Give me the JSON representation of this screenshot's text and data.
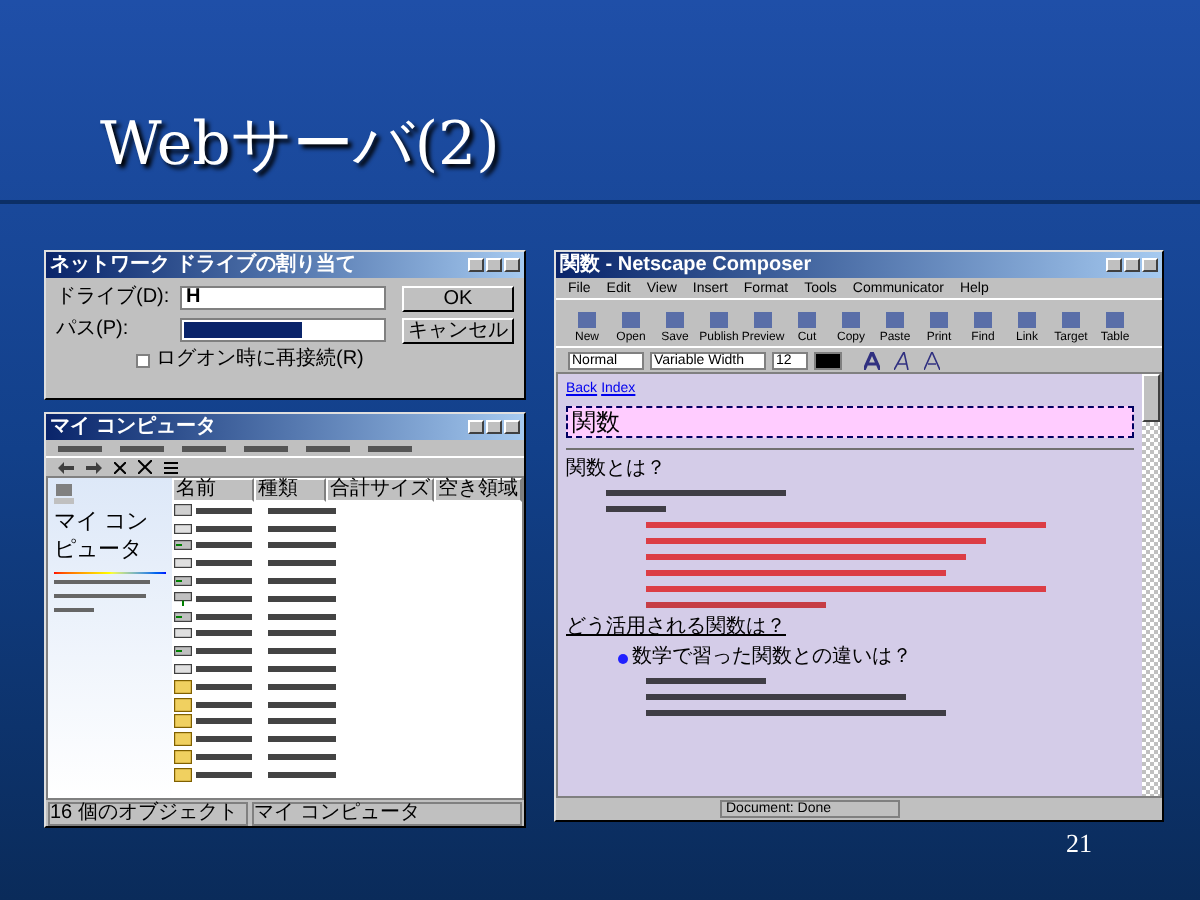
{
  "slide": {
    "title": "Webサーバ(2)",
    "page_number": "21"
  },
  "map_drive_dialog": {
    "title": "ネットワーク ドライブの割り当て",
    "drive_label": "ドライブ(D):",
    "drive_value": "H",
    "path_label": "パス(P):",
    "reconnect": {
      "label": "ログオン時に再接続(R)",
      "checked": false
    },
    "buttons": [
      "OK",
      "キャンセル"
    ]
  },
  "explorer": {
    "title": "マイ コンピュータ",
    "sidebar_title": "マイ コンピュータ",
    "columns": [
      "名前",
      "種類",
      "合計サイズ",
      "空き領域"
    ],
    "rows": [
      {
        "kind": "floppy"
      },
      {
        "kind": "hdd"
      },
      {
        "kind": "cd"
      },
      {
        "kind": "hdd"
      },
      {
        "kind": "cd"
      },
      {
        "kind": "net"
      },
      {
        "kind": "cd"
      },
      {
        "kind": "hdd"
      },
      {
        "kind": "cd"
      },
      {
        "kind": "hdd"
      },
      {
        "kind": "folder"
      },
      {
        "kind": "folder"
      },
      {
        "kind": "folder"
      },
      {
        "kind": "folder"
      },
      {
        "kind": "folder"
      },
      {
        "kind": "folder"
      }
    ],
    "status": [
      "16 個のオブジェクト",
      "マイ コンピュータ"
    ]
  },
  "composer": {
    "title": "関数 - Netscape Composer",
    "menu": [
      "File",
      "Edit",
      "View",
      "Insert",
      "Format",
      "Tools",
      "Communicator",
      "Help"
    ],
    "toolbar": [
      "New",
      "Open",
      "Save",
      "Publish",
      "Preview",
      "Cut",
      "Copy",
      "Paste",
      "Print",
      "Find",
      "Link",
      "Target",
      "Table"
    ],
    "format": [
      "Normal",
      "Variable Width",
      "12"
    ],
    "links": [
      "Back",
      "Index"
    ],
    "heading": "関数",
    "section_1": "関数とは？",
    "section_2": "どう活用される関数は？",
    "bullet": "数学で習った関数との違いは？",
    "status": "Document: Done"
  }
}
